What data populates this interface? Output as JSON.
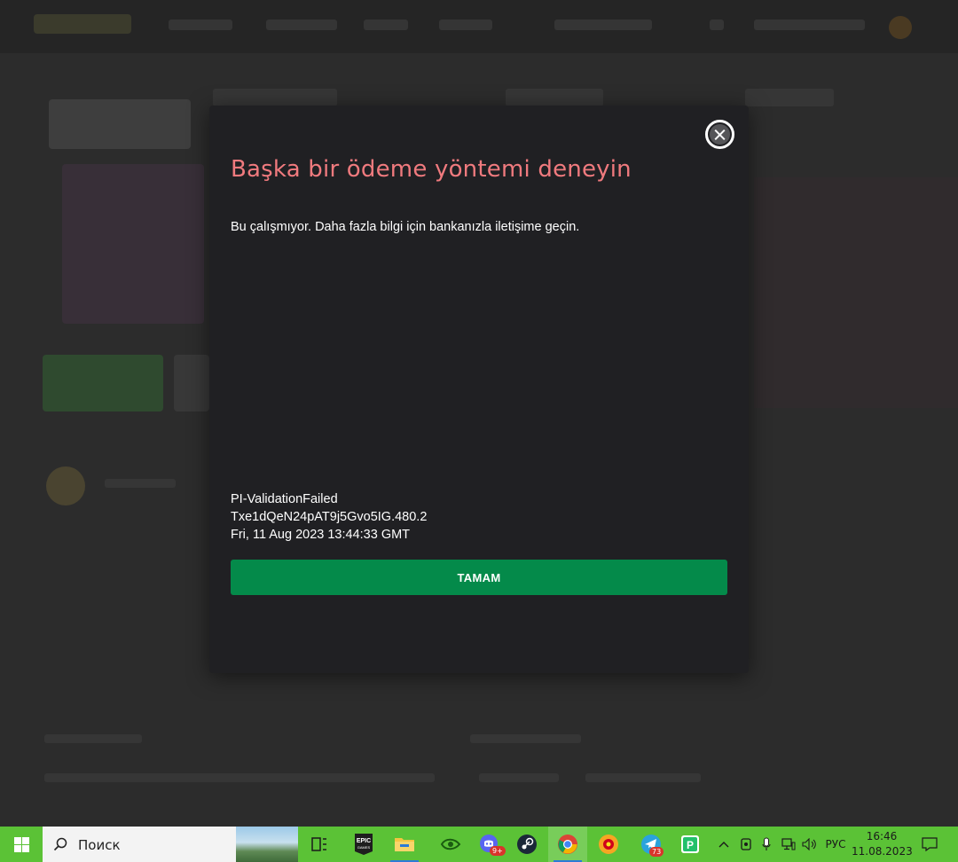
{
  "dialog": {
    "title": "Başka bir ödeme yöntemi deneyin",
    "message": "Bu çalışmıyor. Daha fazla bilgi için bankanızla iletişime geçin.",
    "error_code": "PI-ValidationFailed",
    "transaction_id": "Txe1dQeN24pAT9j5Gvo5IG.480.2",
    "timestamp": "Fri, 11 Aug 2023 13:44:33 GMT",
    "ok_label": "TAMAM",
    "close_icon": "close-icon",
    "title_color": "#f07a7e",
    "button_color": "#048a4a"
  },
  "taskbar": {
    "search_placeholder": "Поиск",
    "pinned_apps": [
      {
        "name": "task-view-icon"
      },
      {
        "name": "epic-games-icon",
        "label": "EPIC GAMES"
      },
      {
        "name": "file-explorer-icon"
      },
      {
        "name": "nvidia-icon"
      },
      {
        "name": "discord-icon",
        "badge": "9+"
      },
      {
        "name": "steam-icon"
      },
      {
        "name": "chrome-icon"
      },
      {
        "name": "app-icon-orange"
      },
      {
        "name": "telegram-icon",
        "badge": "73"
      },
      {
        "name": "pycharm-like-icon"
      }
    ],
    "tray": {
      "language": "РУС",
      "time": "16:46",
      "date": "11.08.2023"
    },
    "color": "#5bc236"
  }
}
